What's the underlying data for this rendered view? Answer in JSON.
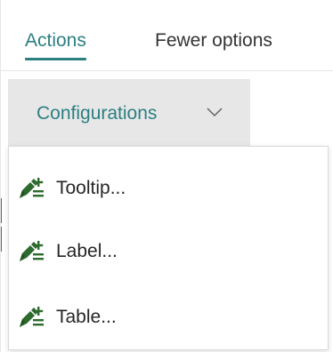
{
  "tabs": {
    "actions_label": "Actions",
    "fewer_options_label": "Fewer options"
  },
  "toolbar": {
    "configurations_label": "Configurations"
  },
  "menu": {
    "items": [
      {
        "label": "Tooltip...",
        "icon": "edit-add-icon"
      },
      {
        "label": "Label...",
        "icon": "edit-add-icon"
      },
      {
        "label": "Table...",
        "icon": "edit-add-icon"
      }
    ]
  },
  "colors": {
    "accent": "#2d7f82",
    "icon": "#2d6a2d",
    "button_bg": "#e7e7e7"
  }
}
